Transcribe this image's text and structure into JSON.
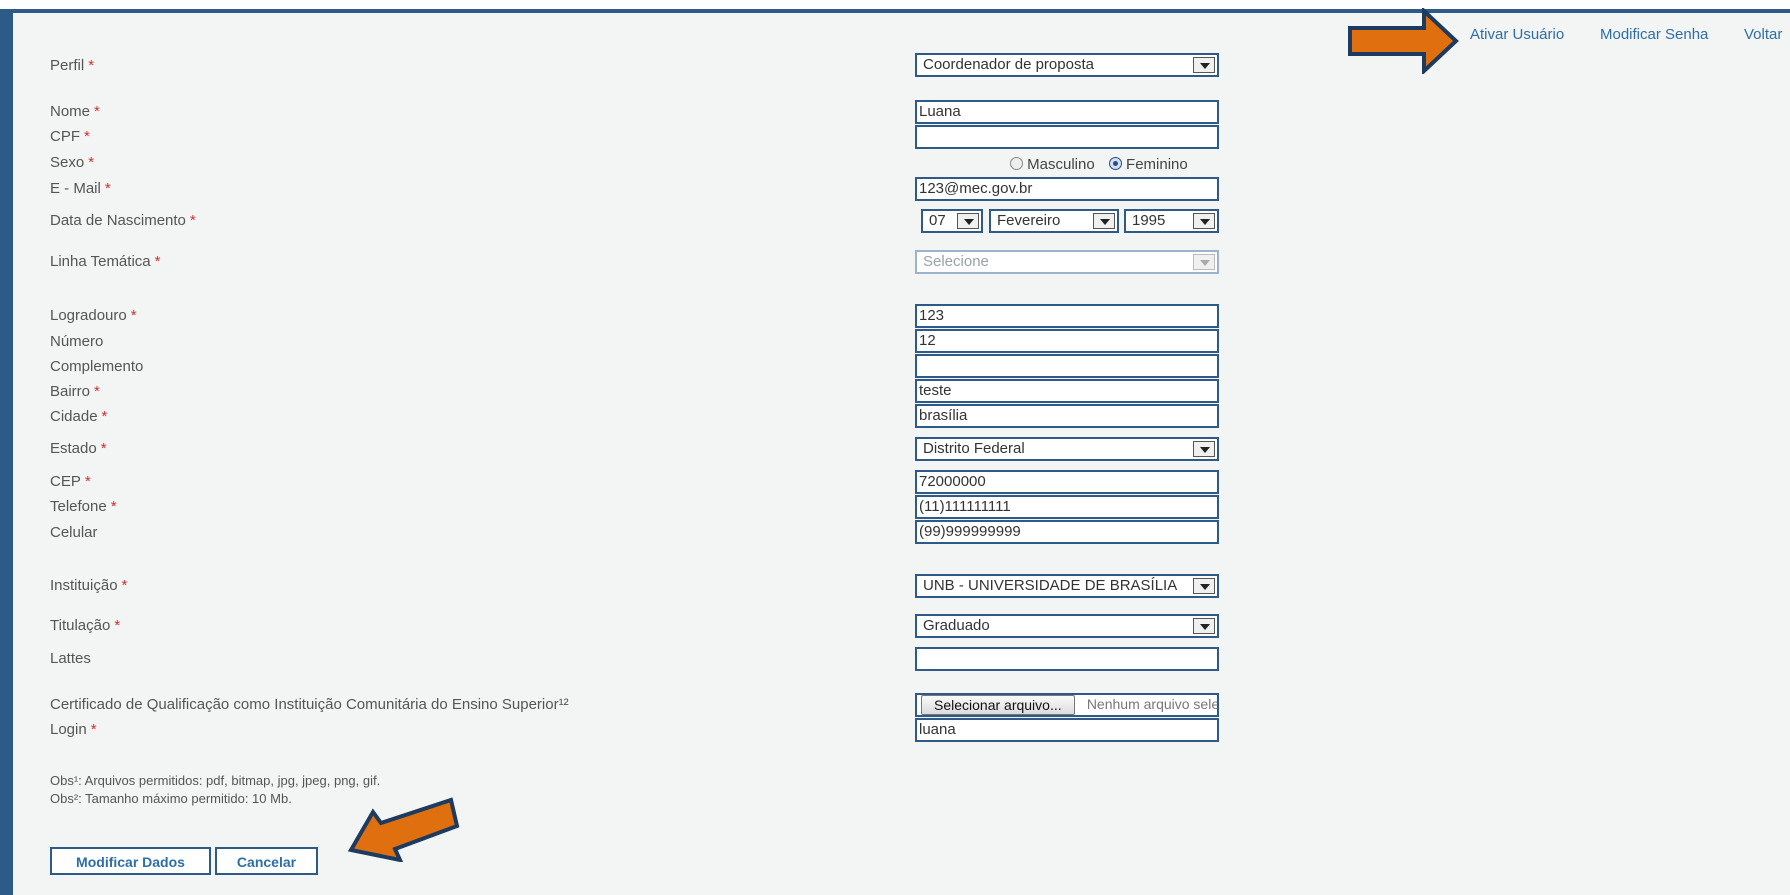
{
  "nav": {
    "ativar": "Ativar Usuário",
    "modificar_senha": "Modificar Senha",
    "voltar": "Voltar"
  },
  "labels": {
    "perfil": "Perfil",
    "nome": "Nome",
    "cpf": "CPF",
    "sexo": "Sexo",
    "email": "E - Mail",
    "nascimento": "Data de Nascimento",
    "linha": "Linha Temática",
    "logradouro": "Logradouro",
    "numero": "Número",
    "complemento": "Complemento",
    "bairro": "Bairro",
    "cidade": "Cidade",
    "estado": "Estado",
    "cep": "CEP",
    "telefone": "Telefone",
    "celular": "Celular",
    "instituicao": "Instituição",
    "titulacao": "Titulação",
    "lattes": "Lattes",
    "certificado": "Certificado de Qualificação como Instituição Comunitária do Ensino Superior¹²",
    "login": "Login"
  },
  "required_mark": "*",
  "values": {
    "perfil": "Coordenador de proposta",
    "nome": "Luana",
    "cpf": "",
    "email": "123@mec.gov.br",
    "dia": "07",
    "mes": "Fevereiro",
    "ano": "1995",
    "linha_placeholder": "Selecione",
    "logradouro": "123",
    "numero": "12",
    "complemento": "",
    "bairro": "teste",
    "cidade": "brasília",
    "estado": "Distrito Federal",
    "cep": "72000000",
    "telefone": "(11)111111111",
    "celular": "(99)999999999",
    "instituicao": "UNB - UNIVERSIDADE DE BRASÍLIA",
    "titulacao": "Graduado",
    "lattes": "",
    "login": "luana"
  },
  "sexo": {
    "masculino": "Masculino",
    "feminino": "Feminino",
    "selected": "Feminino"
  },
  "file": {
    "button": "Selecionar arquivo...",
    "status": "Nenhum arquivo selecionado"
  },
  "obs": {
    "line1": "Obs¹: Arquivos permitidos: pdf, bitmap, jpg, jpeg, png, gif.",
    "line2": "Obs²: Tamanho máximo permitido: 10 Mb."
  },
  "buttons": {
    "modificar": "Modificar Dados",
    "cancelar": "Cancelar"
  },
  "colors": {
    "border_accent": "#2e5a87",
    "link": "#2e6ea6",
    "arrow": "#e06f0f"
  }
}
